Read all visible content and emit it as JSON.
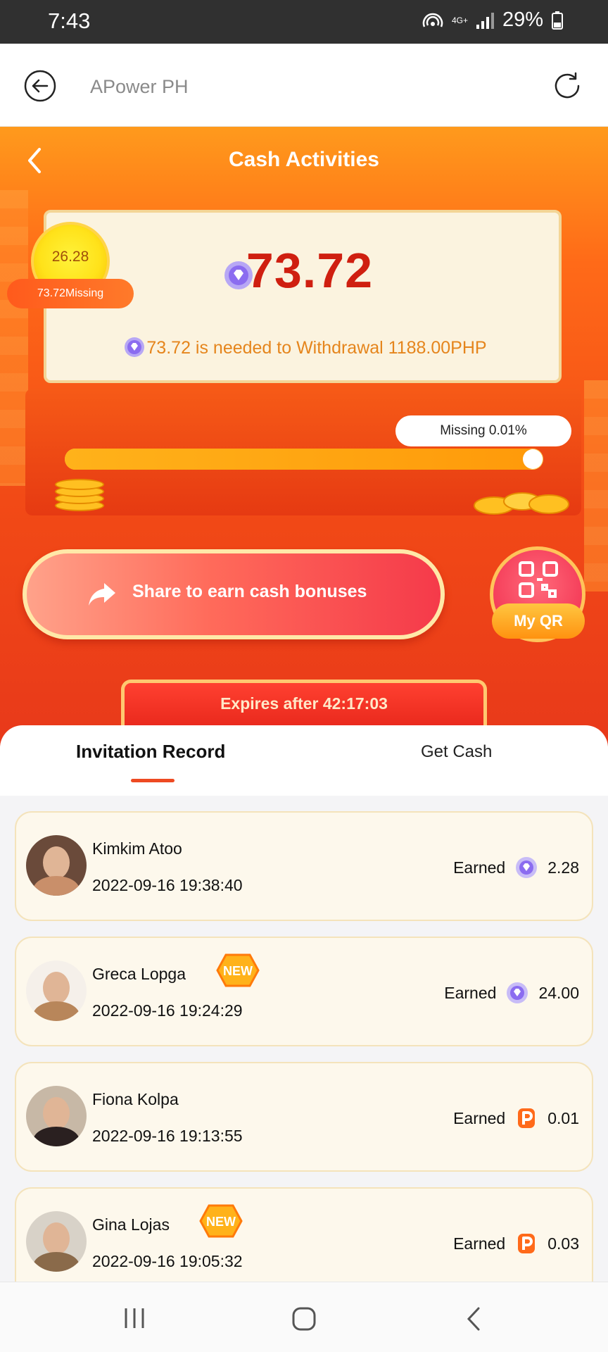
{
  "status_bar": {
    "time": "7:43",
    "network": "4G+",
    "battery": "29%"
  },
  "browser": {
    "title": "APower PH"
  },
  "hero": {
    "title": "Cash Activities",
    "coin_value": "26.28",
    "missing_pill": "73.72Missing",
    "big_amount": "73.72",
    "need_text": "73.72 is needed to Withdrawal 1188.00PHP",
    "missing_tag": "Missing 0.01%",
    "progress_fraction": 0.99,
    "share_label": "Share to earn cash bonuses",
    "qr_label": "My QR",
    "expires_label": "Expires after",
    "expires_time": "42:17:03"
  },
  "tabs": [
    {
      "label": "Invitation Record",
      "active": true
    },
    {
      "label": "Get Cash",
      "active": false
    }
  ],
  "records": [
    {
      "name": "Kimkim Atoo",
      "date": "2022-09-16 19:38:40",
      "earned_label": "Earned",
      "currency_icon": "gem-icon",
      "amount": "2.28",
      "new": false
    },
    {
      "name": "Greca Lopga",
      "date": "2022-09-16 19:24:29",
      "earned_label": "Earned",
      "currency_icon": "gem-icon",
      "amount": "24.00",
      "new": true,
      "new_label": "NEW"
    },
    {
      "name": "Fiona Kolpa",
      "date": "2022-09-16 19:13:55",
      "earned_label": "Earned",
      "currency_icon": "p-coin-icon",
      "amount": "0.01",
      "new": false
    },
    {
      "name": "Gina Lojas",
      "date": "2022-09-16 19:05:32",
      "earned_label": "Earned",
      "currency_icon": "p-coin-icon",
      "amount": "0.03",
      "new": true,
      "new_label": "NEW"
    }
  ],
  "colors": {
    "accent": "#ee4a22",
    "gem": "#8b6cf0",
    "p_coin": "#ff6a1a"
  }
}
